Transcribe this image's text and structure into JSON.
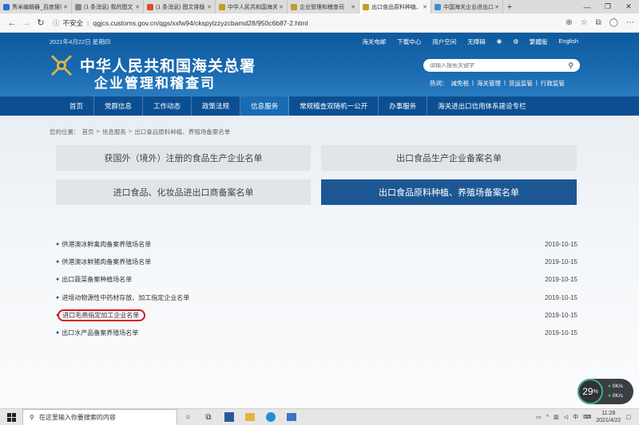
{
  "browser": {
    "tabs": [
      {
        "label": "秀米编辑器_百度搜索",
        "color": "#2d6bd8",
        "active": false
      },
      {
        "label": "(1 条消息) 我的图文",
        "color": "#888888",
        "active": false
      },
      {
        "label": "(1 条消息) 图文排版",
        "color": "#e04a2d",
        "active": false
      },
      {
        "label": "中华人民共和国海关",
        "color": "#c59a2a",
        "active": false
      },
      {
        "label": "企业管理和稽查司",
        "color": "#c59a2a",
        "active": false
      },
      {
        "label": "出口食品原料种植、",
        "color": "#c59a2a",
        "active": true
      },
      {
        "label": "中国海关企业进出口",
        "color": "#3a8fd8",
        "active": false
      }
    ],
    "new_tab": "+",
    "security_label": "不安全",
    "url": "qgjcs.customs.gov.cn/qgs/xxfw94/ckspylzzyzcbamd28/950c6b87-2.html"
  },
  "header": {
    "date": "2021年4月22日 星期四",
    "top_links": [
      "海关电邮",
      "下载中心",
      "用户空间",
      "无障碍",
      "繁體版",
      "English"
    ],
    "title_main": "中华人民共和国海关总署",
    "title_sub": "企业管理和稽查司",
    "search_placeholder": "请输入搜索关键字",
    "hot_label": "热词：",
    "hot_words": [
      "减免税",
      "海关管理",
      "货运监管",
      "行政监管"
    ]
  },
  "nav": {
    "items": [
      "首页",
      "党群信息",
      "工作动态",
      "政策法规",
      "信息服务",
      "常规稽查双随机一公开",
      "办事服务",
      "海关进出口信用体系建设专栏"
    ],
    "active_index": 4
  },
  "breadcrumb": [
    "您的位置：",
    "首页",
    ">",
    "信息服务",
    ">",
    "出口食品原料种植、养殖场备案名单"
  ],
  "categories": [
    {
      "label": "获国外（境外）注册的食品生产企业名单",
      "active": false
    },
    {
      "label": "出口食品生产企业备案名单",
      "active": false
    },
    {
      "label": "进口食品、化妆品进出口商备案名单",
      "active": false
    },
    {
      "label": "出口食品原料种植、养殖场备案名单",
      "active": true
    }
  ],
  "list": [
    {
      "name": "供港澳冰鲜禽肉备案养殖场名单",
      "date": "2019-10-15"
    },
    {
      "name": "供港澳冰鲜猪肉备案养殖场名单",
      "date": "2019-10-15"
    },
    {
      "name": "出口蔬菜备案种植场名单",
      "date": "2019-10-15"
    },
    {
      "name": "进境动物源性中药材存放、加工指定企业名单",
      "date": "2019-10-15"
    },
    {
      "name": "进口毛燕指定加工企业名单",
      "date": "2019-10-15",
      "highlighted": true
    },
    {
      "name": "出口水产品备案养殖场名单",
      "date": "2019-10-15"
    }
  ],
  "widget": {
    "percent": "29",
    "percent_unit": "%",
    "up": "0K/s",
    "down": "0K/s"
  },
  "taskbar": {
    "search_placeholder": "在这里输入你要搜索的内容",
    "time": "11:28",
    "date": "2021/4/22",
    "ime": "中"
  }
}
